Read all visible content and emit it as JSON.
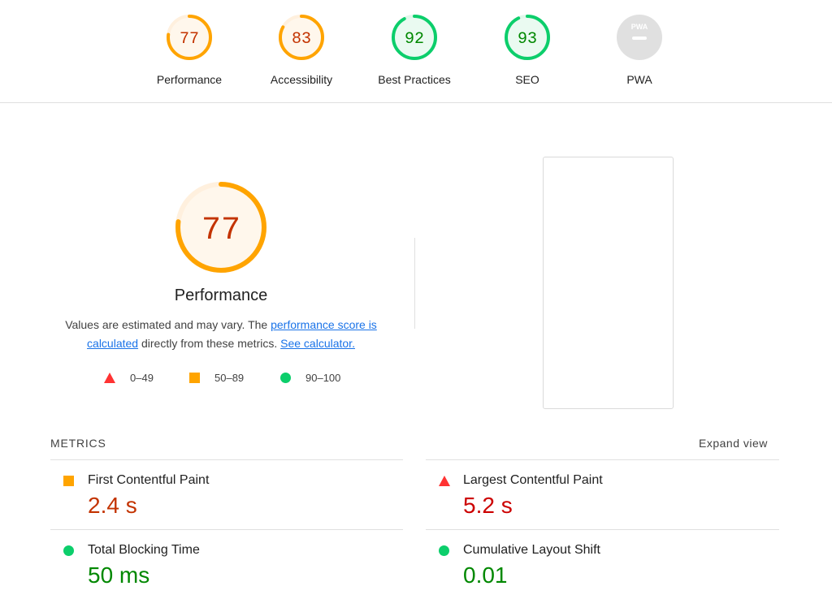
{
  "colors": {
    "fail": "#ff3333",
    "average": "#ffa400",
    "pass": "#0cce6b",
    "fail_text": "#c33300",
    "pass_text": "#008800",
    "na": "#cccccc",
    "link": "#1a73e8"
  },
  "summary": [
    {
      "score": "77",
      "label": "Performance",
      "rating": "average"
    },
    {
      "score": "83",
      "label": "Accessibility",
      "rating": "average"
    },
    {
      "score": "92",
      "label": "Best Practices",
      "rating": "pass"
    },
    {
      "score": "93",
      "label": "SEO",
      "rating": "pass"
    },
    {
      "score": "",
      "label": "PWA",
      "rating": "na",
      "badge_text": "PWA"
    }
  ],
  "performance": {
    "score": "77",
    "fraction": 0.77,
    "title": "Performance",
    "desc_prefix": "Values are estimated and may vary. The ",
    "desc_link1": "performance score is calculated",
    "desc_middle": " directly from these metrics. ",
    "desc_link2": "See calculator."
  },
  "legend": {
    "fail": "0–49",
    "average": "50–89",
    "pass": "90–100"
  },
  "metrics": {
    "header": "METRICS",
    "expand": "Expand view",
    "items": [
      {
        "name": "First Contentful Paint",
        "value": "2.4 s",
        "rating": "average"
      },
      {
        "name": "Largest Contentful Paint",
        "value": "5.2 s",
        "rating": "fail"
      },
      {
        "name": "Total Blocking Time",
        "value": "50 ms",
        "rating": "pass"
      },
      {
        "name": "Cumulative Layout Shift",
        "value": "0.01",
        "rating": "pass"
      }
    ]
  }
}
